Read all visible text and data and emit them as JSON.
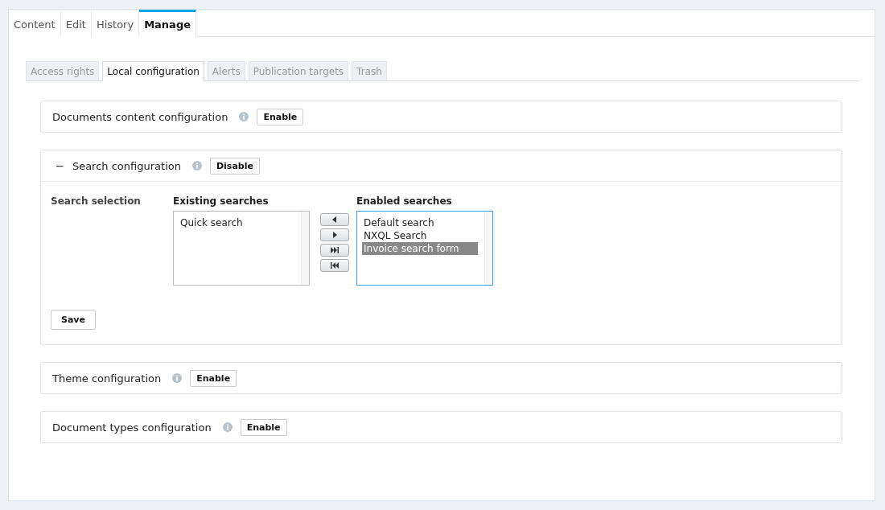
{
  "tabs": [
    {
      "label": "Content",
      "selected": false
    },
    {
      "label": "Edit",
      "selected": false
    },
    {
      "label": "History",
      "selected": false
    },
    {
      "label": "Manage",
      "selected": true
    }
  ],
  "subtabs": [
    {
      "label": "Access rights",
      "selected": false
    },
    {
      "label": "Local configuration",
      "selected": true
    },
    {
      "label": "Alerts",
      "selected": false
    },
    {
      "label": "Publication targets",
      "selected": false
    },
    {
      "label": "Trash",
      "selected": false
    }
  ],
  "sections": [
    {
      "title": "Documents content configuration",
      "button": "Enable",
      "expanded": false
    },
    {
      "title": "Search configuration",
      "button": "Disable",
      "expanded": true,
      "toggle": "−",
      "field_label": "Search selection",
      "existing_label": "Existing searches",
      "existing": [
        {
          "label": "Quick search",
          "selected": false
        }
      ],
      "enabled_label": "Enabled searches",
      "enabled": [
        {
          "label": "Default search",
          "selected": false
        },
        {
          "label": "NXQL Search",
          "selected": false
        },
        {
          "label": "Invoice search form",
          "selected": true
        }
      ],
      "save": "Save"
    },
    {
      "title": "Theme configuration",
      "button": "Enable",
      "expanded": false
    },
    {
      "title": "Document types configuration",
      "button": "Enable",
      "expanded": false
    }
  ]
}
